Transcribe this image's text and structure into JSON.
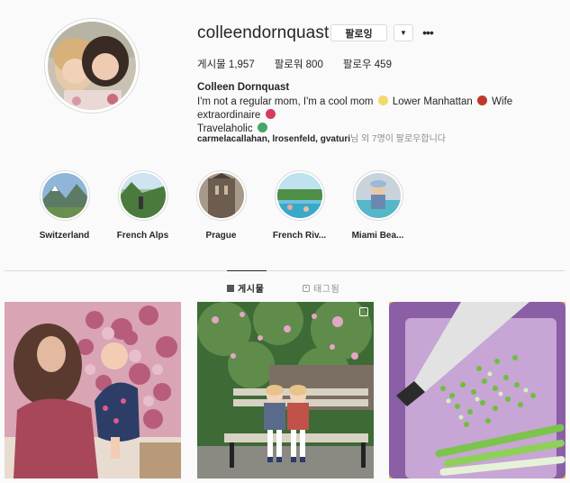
{
  "profile": {
    "username": "colleendornquast",
    "follow_button": "팔로잉",
    "dropdown_glyph": "▼",
    "more_glyph": "•••",
    "stats": {
      "posts": "게시물 1,957",
      "followers": "팔로워 800",
      "following": "팔로우 459"
    },
    "full_name": "Colleen Dornquast",
    "bio_part1": "I'm not a regular mom, I'm a cool mom",
    "bio_part2": "Lower Manhattan",
    "bio_part3": "Wife extraordinaire",
    "bio_part4": "Travelaholic",
    "followed_by_names": "carmelacallahan, lrosenfeld, gvaturi",
    "followed_by_suffix": "님 외 7명이 팔로우합니다"
  },
  "highlights": [
    {
      "label": "Switzerland"
    },
    {
      "label": "French Alps"
    },
    {
      "label": "Prague"
    },
    {
      "label": "French Riv..."
    },
    {
      "label": "Miami Bea..."
    }
  ],
  "tabs": {
    "posts": "게시물",
    "tagged": "태그됨"
  },
  "colors": {
    "accent": "#262626",
    "muted": "#8e8e8e",
    "border": "#dbdbdb",
    "background": "#fafafa"
  }
}
